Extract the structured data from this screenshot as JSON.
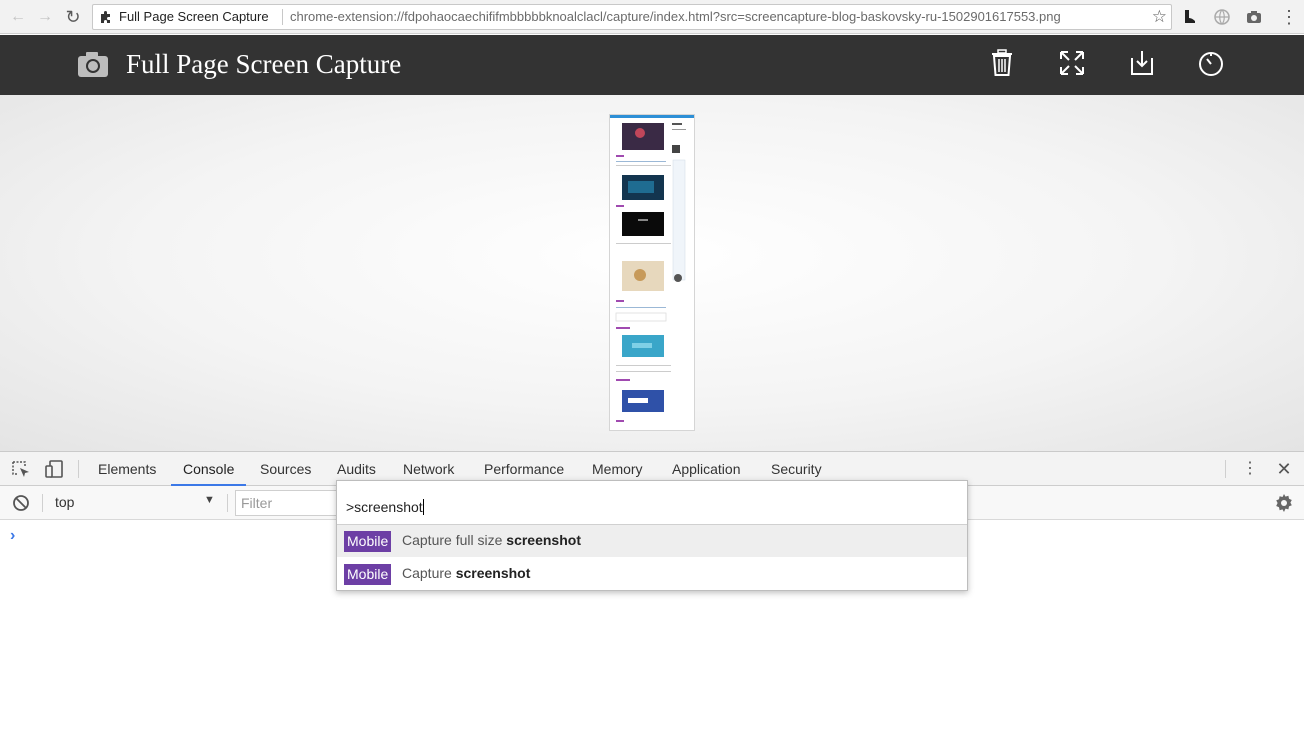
{
  "browser": {
    "site_label": "Full Page Screen Capture",
    "url": "chrome-extension://fdpohaocaechififmbbbbbknoalclacl/capture/index.html?src=screencapture-blog-baskovsky-ru-1502901617553.png",
    "icons": [
      "back-arrow-icon",
      "forward-arrow-icon",
      "reload-icon",
      "puzzle-piece-icon",
      "star-icon",
      "boot-icon",
      "globe-icon",
      "camera-icon",
      "kebab-menu-icon"
    ]
  },
  "app": {
    "title": "Full Page Screen Capture",
    "header_bg": "#333333",
    "icons": [
      "camera-icon",
      "trash-icon",
      "expand-icon",
      "download-icon",
      "timer-icon"
    ]
  },
  "devtools": {
    "tabs": [
      "Elements",
      "Console",
      "Sources",
      "Audits",
      "Network",
      "Performance",
      "Memory",
      "Application",
      "Security"
    ],
    "active_tab": "Console",
    "context": "top",
    "filter_placeholder": "Filter",
    "prompt": "›"
  },
  "command_menu": {
    "query": ">screenshot",
    "items": [
      {
        "badge": "Mobile",
        "prefix": "Capture full size ",
        "match": "screenshot",
        "selected": true
      },
      {
        "badge": "Mobile",
        "prefix": "Capture ",
        "match": "screenshot",
        "selected": false
      }
    ],
    "badge_color": "#6d3fa5"
  }
}
